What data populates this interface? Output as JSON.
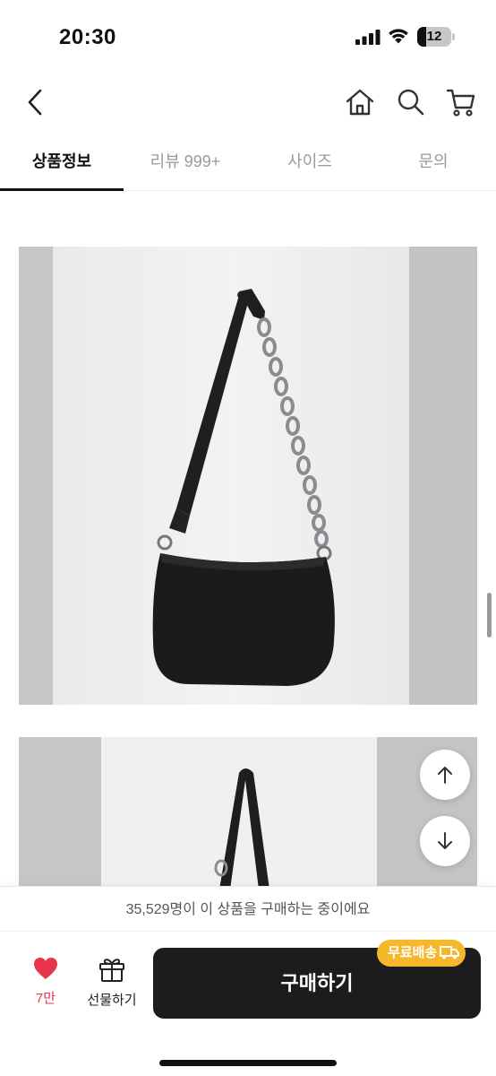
{
  "status_bar": {
    "time": "20:30",
    "battery": "12"
  },
  "tabs": [
    {
      "label": "상품정보",
      "active": true
    },
    {
      "label": "리뷰 999+",
      "active": false
    },
    {
      "label": "사이즈",
      "active": false
    },
    {
      "label": "문의",
      "active": false
    }
  ],
  "bottom_bar": {
    "buying_notice": "35,529명이 이 상품을 구매하는 중이에요",
    "like_count": "7만",
    "gift_label": "선물하기",
    "buy_label": "구매하기",
    "free_shipping_badge": "무료배송",
    "accent_color": "#e8354b",
    "badge_color": "#f7b72a"
  }
}
